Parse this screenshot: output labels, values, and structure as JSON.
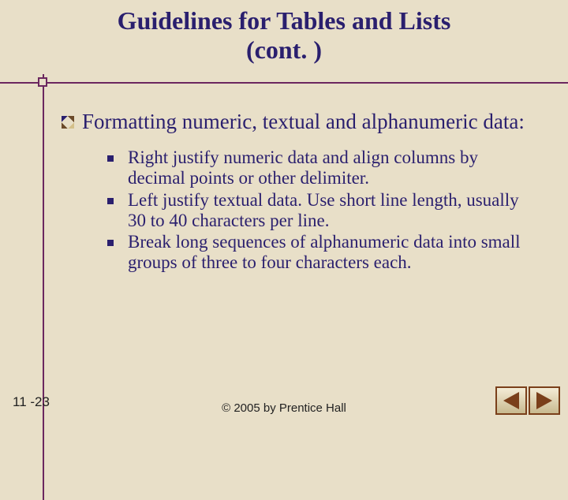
{
  "title_line1": "Guidelines for Tables and Lists",
  "title_line2": "(cont. )",
  "main_bullet": "Formatting numeric, textual and alphanumeric data:",
  "sub_bullets": {
    "b0": "Right justify numeric data and align columns by decimal points or other delimiter.",
    "b1": "Left justify textual data.  Use short line length, usually 30 to 40 characters per line.",
    "b2": "Break long sequences of alphanumeric data into small groups of three to four characters each."
  },
  "page_number": "11 -23",
  "copyright": "© 2005 by Prentice Hall",
  "nav": {
    "prev": "Previous",
    "next": "Next"
  }
}
